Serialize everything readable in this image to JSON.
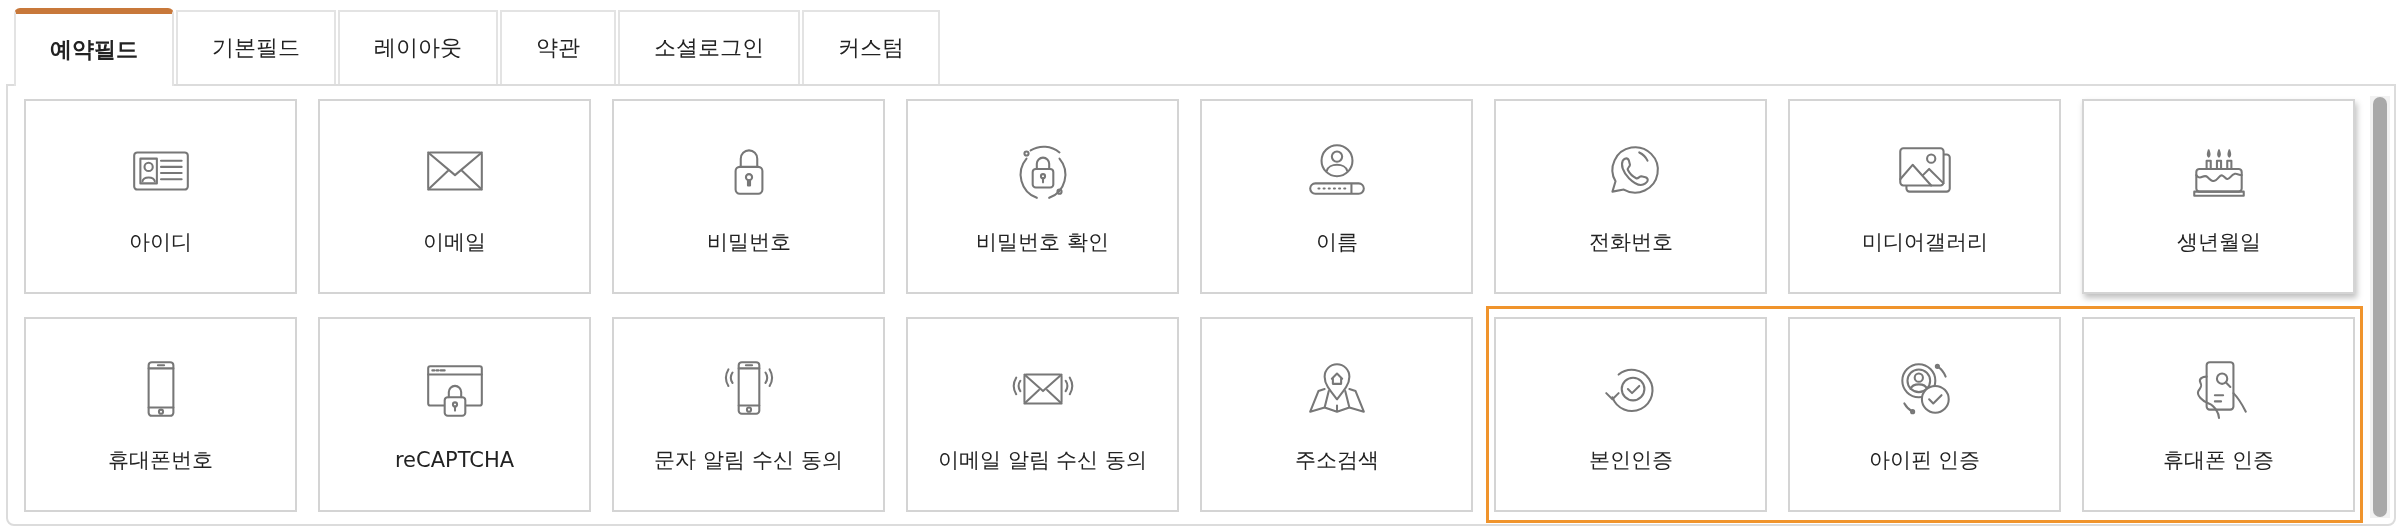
{
  "tabs": [
    {
      "label": "예약필드",
      "selected": true
    },
    {
      "label": "기본필드",
      "selected": false
    },
    {
      "label": "레이아웃",
      "selected": false
    },
    {
      "label": "약관",
      "selected": false
    },
    {
      "label": "소셜로그인",
      "selected": false
    },
    {
      "label": "커스텀",
      "selected": false
    }
  ],
  "rows": [
    {
      "items": [
        {
          "label": "아이디",
          "highlighted": false,
          "hovered": false
        },
        {
          "label": "이메일",
          "highlighted": false,
          "hovered": false
        },
        {
          "label": "비밀번호",
          "highlighted": false,
          "hovered": false
        },
        {
          "label": "비밀번호 확인",
          "highlighted": false,
          "hovered": false
        },
        {
          "label": "이름",
          "highlighted": false,
          "hovered": false
        },
        {
          "label": "전화번호",
          "highlighted": false,
          "hovered": false
        },
        {
          "label": "미디어갤러리",
          "highlighted": false,
          "hovered": false
        },
        {
          "label": "생년월일",
          "highlighted": false,
          "hovered": true
        }
      ]
    },
    {
      "items": [
        {
          "label": "휴대폰번호",
          "highlighted": false,
          "hovered": false
        },
        {
          "label": "reCAPTCHA",
          "highlighted": false,
          "hovered": false
        },
        {
          "label": "문자 알림 수신 동의",
          "highlighted": false,
          "hovered": false
        },
        {
          "label": "이메일 알림 수신 동의",
          "highlighted": false,
          "hovered": false
        },
        {
          "label": "주소검색",
          "highlighted": false,
          "hovered": false
        },
        {
          "label": "본인인증",
          "highlighted": true,
          "hovered": false
        },
        {
          "label": "아이핀 인증",
          "highlighted": true,
          "hovered": false
        },
        {
          "label": "휴대폰 인증",
          "highlighted": true,
          "hovered": false
        }
      ]
    }
  ]
}
